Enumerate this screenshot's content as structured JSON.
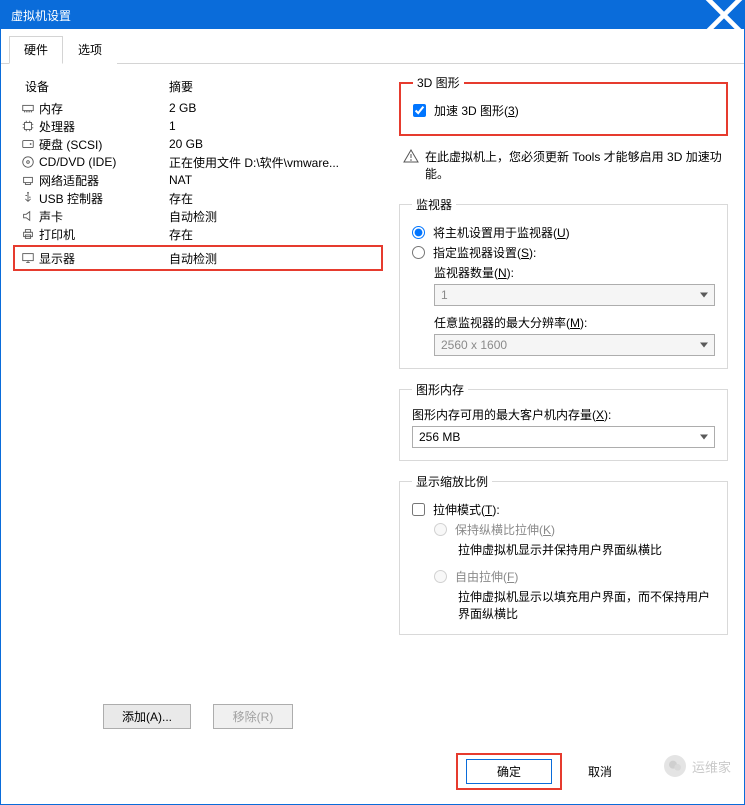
{
  "window": {
    "title": "虚拟机设置"
  },
  "tabs": {
    "hardware": "硬件",
    "options": "选项"
  },
  "devices": {
    "header_device": "设备",
    "header_summary": "摘要",
    "items": [
      {
        "name": "内存",
        "summary": "2 GB"
      },
      {
        "name": "处理器",
        "summary": "1"
      },
      {
        "name": "硬盘 (SCSI)",
        "summary": "20 GB"
      },
      {
        "name": "CD/DVD (IDE)",
        "summary": "正在使用文件 D:\\软件\\vmware..."
      },
      {
        "name": "网络适配器",
        "summary": "NAT"
      },
      {
        "name": "USB 控制器",
        "summary": "存在"
      },
      {
        "name": "声卡",
        "summary": "自动检测"
      },
      {
        "name": "打印机",
        "summary": "存在"
      },
      {
        "name": "显示器",
        "summary": "自动检测"
      }
    ],
    "add_btn": "添加(A)...",
    "remove_btn": "移除(R)"
  },
  "graphics3d": {
    "legend": "3D 图形",
    "accel_prefix": "加速 3D 图形(",
    "accel_u": "3",
    "accel_suffix": ")",
    "warn": "在此虚拟机上，您必须更新 Tools 才能够启用 3D 加速功能。"
  },
  "monitors": {
    "legend": "监视器",
    "use_host_prefix": "将主机设置用于监视器(",
    "use_host_u": "U",
    "use_host_suffix": ")",
    "specify_prefix": "指定监视器设置(",
    "specify_u": "S",
    "specify_suffix": "):",
    "count_label_prefix": "监视器数量(",
    "count_label_u": "N",
    "count_label_suffix": "):",
    "count_value": "1",
    "maxres_label_prefix": "任意监视器的最大分辨率(",
    "maxres_label_u": "M",
    "maxres_label_suffix": "):",
    "maxres_value": "2560 x 1600"
  },
  "gmem": {
    "legend": "图形内存",
    "label_prefix": "图形内存可用的最大客户机内存量(",
    "label_u": "X",
    "label_suffix": "):",
    "value": "256 MB"
  },
  "scale": {
    "legend": "显示缩放比例",
    "stretch_prefix": "拉伸模式(",
    "stretch_u": "T",
    "stretch_suffix": "):",
    "keep_ratio_prefix": "保持纵横比拉伸(",
    "keep_ratio_u": "K",
    "keep_ratio_suffix": ")",
    "keep_ratio_desc": "拉伸虚拟机显示并保持用户界面纵横比",
    "free_prefix": "自由拉伸(",
    "free_u": "F",
    "free_suffix": ")",
    "free_desc": "拉伸虚拟机显示以填充用户界面，而不保持用户界面纵横比"
  },
  "buttons": {
    "ok": "确定",
    "cancel": "取消"
  },
  "watermark": "运维家"
}
